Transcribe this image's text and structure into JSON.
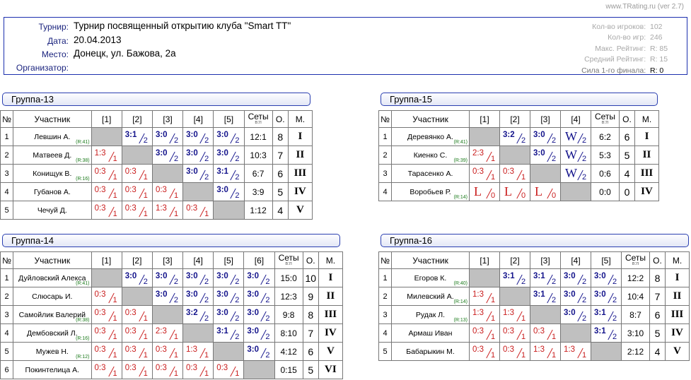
{
  "site": "www.TRating.ru (ver 2.7)",
  "info": {
    "labels": {
      "tournament": "Турнир:",
      "date": "Дата:",
      "place": "Место:",
      "organizer": "Организатор:"
    },
    "tournament": "Турнир посвященный открытию клуба \"Smart TT\"",
    "date": "20.04.2013",
    "place": "Донецк, ул. Бажова, 2а",
    "organizer": ""
  },
  "stats": [
    {
      "k": "Кол-во игроков:",
      "v": "102"
    },
    {
      "k": "Кол-во игр:",
      "v": "246"
    },
    {
      "k": "Макс. Рейтинг:",
      "v": "R:  85"
    },
    {
      "k": "Средний Рейтинг:",
      "v": "R:  15"
    },
    {
      "k": "Сила 1-го финала:",
      "v": "R:   0"
    }
  ],
  "headers": {
    "num": "№",
    "player": "Участник",
    "sets": "Сеты",
    "sets_sub": "в:п",
    "points": "О.",
    "place": "М."
  },
  "groups": [
    {
      "title": "Группа-13",
      "cols": [
        "[1]",
        "[2]",
        "[3]",
        "[4]",
        "[5]"
      ],
      "rows": [
        {
          "n": "1",
          "name": "Левшин А.",
          "rating": "(R:41)",
          "results": [
            null,
            "3:1|2",
            "3:0|2",
            "3:0|2",
            "3:0|2"
          ],
          "sets": "12:1",
          "pts": "8",
          "place": "I"
        },
        {
          "n": "2",
          "name": "Матвеев Д.",
          "rating": "(R:38)",
          "results": [
            "1:3|1",
            null,
            "3:0|2",
            "3:0|2",
            "3:0|2"
          ],
          "sets": "10:3",
          "pts": "7",
          "place": "II"
        },
        {
          "n": "3",
          "name": "Конищук В.",
          "rating": "(R:16)",
          "results": [
            "0:3|1",
            "0:3|1",
            null,
            "3:0|2",
            "3:1|2"
          ],
          "sets": "6:7",
          "pts": "6",
          "place": "III"
        },
        {
          "n": "4",
          "name": "Губанов А.",
          "rating": "",
          "results": [
            "0:3|1",
            "0:3|1",
            "0:3|1",
            null,
            "3:0|2"
          ],
          "sets": "3:9",
          "pts": "5",
          "place": "IV"
        },
        {
          "n": "5",
          "name": "Чечуй Д.",
          "rating": "",
          "results": [
            "0:3|1",
            "0:3|1",
            "1:3|1",
            "0:3|1",
            null
          ],
          "sets": "1:12",
          "pts": "4",
          "place": "V"
        }
      ]
    },
    {
      "title": "Группа-15",
      "cols": [
        "[1]",
        "[2]",
        "[3]",
        "[4]"
      ],
      "rows": [
        {
          "n": "1",
          "name": "Деревянко А.",
          "rating": "(R:41)",
          "results": [
            null,
            "3:2|2",
            "3:0|2",
            "W|2"
          ],
          "sets": "6:2",
          "pts": "6",
          "place": "I"
        },
        {
          "n": "2",
          "name": "Киенко С.",
          "rating": "(R:39)",
          "results": [
            "2:3|1",
            null,
            "3:0|2",
            "W|2"
          ],
          "sets": "5:3",
          "pts": "5",
          "place": "II"
        },
        {
          "n": "3",
          "name": "Тарасенко А.",
          "rating": "",
          "results": [
            "0:3|1",
            "0:3|1",
            null,
            "W|2"
          ],
          "sets": "0:6",
          "pts": "4",
          "place": "III"
        },
        {
          "n": "4",
          "name": "Воробьев Р.",
          "rating": "(R:14)",
          "results": [
            "L|0",
            "L|0",
            "L|0",
            null
          ],
          "sets": "0:0",
          "pts": "0",
          "place": "IV"
        }
      ]
    },
    {
      "title": "Группа-14",
      "cols": [
        "[1]",
        "[2]",
        "[3]",
        "[4]",
        "[5]",
        "[6]"
      ],
      "rows": [
        {
          "n": "1",
          "name": "Дуйловский Алекса",
          "rating": "(R:41)",
          "results": [
            null,
            "3:0|2",
            "3:0|2",
            "3:0|2",
            "3:0|2",
            "3:0|2"
          ],
          "sets": "15:0",
          "pts": "10",
          "place": "I"
        },
        {
          "n": "2",
          "name": "Слюсарь И.",
          "rating": "",
          "results": [
            "0:3|1",
            null,
            "3:0|2",
            "3:0|2",
            "3:0|2",
            "3:0|2"
          ],
          "sets": "12:3",
          "pts": "9",
          "place": "II"
        },
        {
          "n": "3",
          "name": "Самойлик Валерий",
          "rating": "(R:38)",
          "results": [
            "0:3|1",
            "0:3|1",
            null,
            "3:2|2",
            "3:0|2",
            "3:0|2"
          ],
          "sets": "9:8",
          "pts": "8",
          "place": "III"
        },
        {
          "n": "4",
          "name": "Дембовский Л.",
          "rating": "(R:16)",
          "results": [
            "0:3|1",
            "0:3|1",
            "2:3|1",
            null,
            "3:1|2",
            "3:0|2"
          ],
          "sets": "8:10",
          "pts": "7",
          "place": "IV"
        },
        {
          "n": "5",
          "name": "Мужев Н.",
          "rating": "(R:12)",
          "results": [
            "0:3|1",
            "0:3|1",
            "0:3|1",
            "1:3|1",
            null,
            "3:0|2"
          ],
          "sets": "4:12",
          "pts": "6",
          "place": "V"
        },
        {
          "n": "6",
          "name": "Покинтелица А.",
          "rating": "",
          "results": [
            "0:3|1",
            "0:3|1",
            "0:3|1",
            "0:3|1",
            "0:3|1",
            null
          ],
          "sets": "0:15",
          "pts": "5",
          "place": "VI"
        }
      ]
    },
    {
      "title": "Группа-16",
      "cols": [
        "[1]",
        "[2]",
        "[3]",
        "[4]",
        "[5]"
      ],
      "rows": [
        {
          "n": "1",
          "name": "Егоров К.",
          "rating": "(R:40)",
          "results": [
            null,
            "3:1|2",
            "3:1|2",
            "3:0|2",
            "3:0|2"
          ],
          "sets": "12:2",
          "pts": "8",
          "place": "I"
        },
        {
          "n": "2",
          "name": "Милевский А.",
          "rating": "(R:14)",
          "results": [
            "1:3|1",
            null,
            "3:1|2",
            "3:0|2",
            "3:0|2"
          ],
          "sets": "10:4",
          "pts": "7",
          "place": "II"
        },
        {
          "n": "3",
          "name": "Рудак Л.",
          "rating": "(R:13)",
          "results": [
            "1:3|1",
            "1:3|1",
            null,
            "3:0|2",
            "3:1|2"
          ],
          "sets": "8:7",
          "pts": "6",
          "place": "III"
        },
        {
          "n": "4",
          "name": "Армаш Иван",
          "rating": "",
          "results": [
            "0:3|1",
            "0:3|1",
            "0:3|1",
            null,
            "3:1|2"
          ],
          "sets": "3:10",
          "pts": "5",
          "place": "IV"
        },
        {
          "n": "5",
          "name": "Бабарыкин М.",
          "rating": "",
          "results": [
            "0:3|1",
            "0:3|1",
            "1:3|1",
            "1:3|1",
            null
          ],
          "sets": "2:12",
          "pts": "4",
          "place": "V"
        }
      ]
    }
  ]
}
